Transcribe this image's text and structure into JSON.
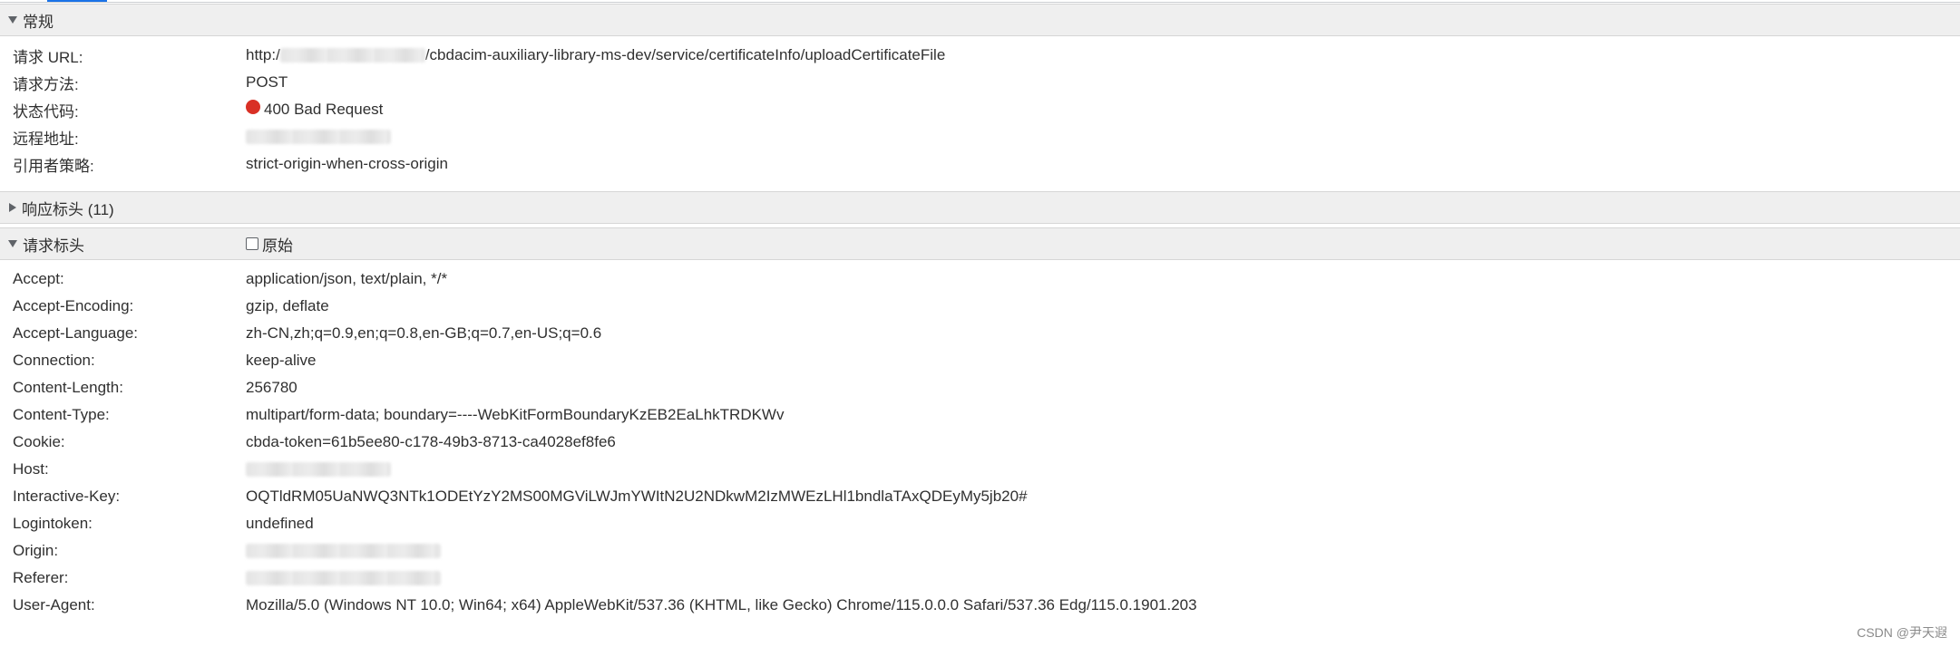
{
  "general": {
    "title": "常规",
    "rows": [
      {
        "key": "请求 URL:",
        "value_suffix": "/cbdacim-auxiliary-library-ms-dev/service/certificateInfo/uploadCertificateFile",
        "value_prefix": "http:/"
      },
      {
        "key": "请求方法:",
        "value": "POST"
      },
      {
        "key": "状态代码:",
        "value": "400 Bad Request",
        "status_color": "#d93025"
      },
      {
        "key": "远程地址:",
        "value": ""
      },
      {
        "key": "引用者策略:",
        "value": "strict-origin-when-cross-origin"
      }
    ]
  },
  "response_headers": {
    "title": "响应标头 (11)"
  },
  "request_headers": {
    "title": "请求标头",
    "raw_label": "原始",
    "rows": [
      {
        "key": "Accept:",
        "value": "application/json, text/plain, */*"
      },
      {
        "key": "Accept-Encoding:",
        "value": "gzip, deflate"
      },
      {
        "key": "Accept-Language:",
        "value": "zh-CN,zh;q=0.9,en;q=0.8,en-GB;q=0.7,en-US;q=0.6"
      },
      {
        "key": "Connection:",
        "value": "keep-alive"
      },
      {
        "key": "Content-Length:",
        "value": "256780"
      },
      {
        "key": "Content-Type:",
        "value": "multipart/form-data; boundary=----WebKitFormBoundaryKzEB2EaLhkTRDKWv"
      },
      {
        "key": "Cookie:",
        "value": "cbda-token=61b5ee80-c178-49b3-8713-ca4028ef8fe6"
      },
      {
        "key": "Host:",
        "value": ""
      },
      {
        "key": "Interactive-Key:",
        "value": "OQTldRM05UaNWQ3NTk1ODEtYzY2MS00MGViLWJmYWItN2U2NDkwM2IzMWEzLHl1bndlaTAxQDEyMy5jb20#"
      },
      {
        "key": "Logintoken:",
        "value": "undefined"
      },
      {
        "key": "Origin:",
        "value": ""
      },
      {
        "key": "Referer:",
        "value": ""
      },
      {
        "key": "User-Agent:",
        "value": "Mozilla/5.0 (Windows NT 10.0; Win64; x64) AppleWebKit/537.36 (KHTML, like Gecko) Chrome/115.0.0.0 Safari/537.36 Edg/115.0.1901.203"
      }
    ]
  },
  "watermark": "CSDN @尹天遐"
}
